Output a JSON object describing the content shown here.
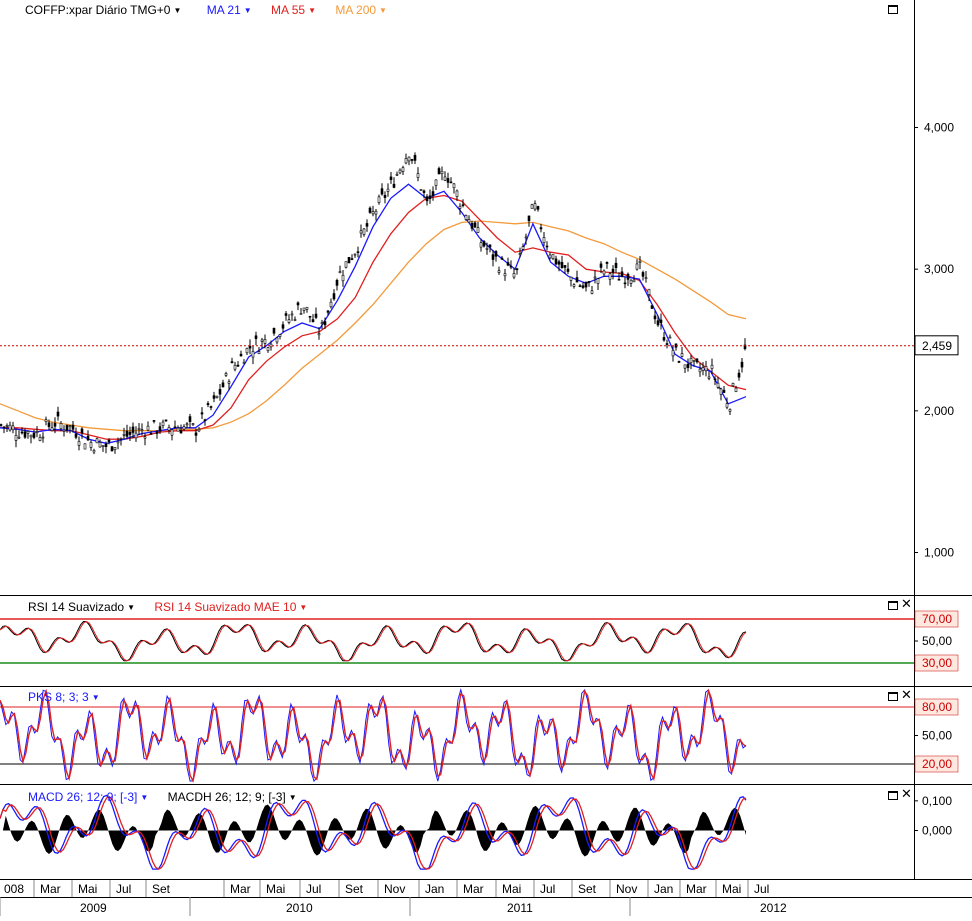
{
  "main": {
    "symbol_label": "COFFP:xpar Diário TMG+0",
    "indicators": [
      {
        "label": "MA 21",
        "color": "#1a1aff"
      },
      {
        "label": "MA 55",
        "color": "#e02020"
      },
      {
        "label": "MA 200",
        "color": "#f39a3c"
      }
    ],
    "price_ticks": [
      "4,000",
      "3,000",
      "2,000",
      "1,000"
    ],
    "last_price": "2,459"
  },
  "rsi": {
    "labels": [
      {
        "label": "RSI 14 Suavizado",
        "color": "#000000"
      },
      {
        "label": "RSI 14 Suavizado MAE 10",
        "color": "#e02020"
      }
    ],
    "ticks": [
      "70,00",
      "50,00",
      "30,00"
    ]
  },
  "pks": {
    "label": "PKS 8; 3; 3",
    "ticks": [
      "80,00",
      "50,00",
      "20,00"
    ]
  },
  "macd": {
    "labels": [
      {
        "label": "MACD 26; 12; 9; [-3]",
        "color": "#1a1aff"
      },
      {
        "label": "MACDH 26; 12; 9; [-3]",
        "color": "#000000"
      }
    ],
    "ticks": [
      "0,100",
      "0,000"
    ]
  },
  "xaxis": {
    "months": [
      "008",
      "Mar",
      "Mai",
      "Jul",
      "Set",
      "Mar",
      "Mai",
      "Jul",
      "Set",
      "Nov",
      "Jan",
      "Mar",
      "Mai",
      "Jul",
      "Set",
      "Nov",
      "Jan",
      "Mar",
      "Mai",
      "Jul"
    ],
    "years": [
      "2009",
      "2010",
      "2011",
      "2012"
    ]
  },
  "chart_data": {
    "type": "line",
    "x": [
      "2008-12",
      "2009-01",
      "2009-02",
      "2009-03",
      "2009-04",
      "2009-05",
      "2009-06",
      "2009-07",
      "2009-08",
      "2009-09",
      "2009-10",
      "2009-11",
      "2009-12",
      "2010-01",
      "2010-02",
      "2010-03",
      "2010-04",
      "2010-05",
      "2010-06",
      "2010-07",
      "2010-08",
      "2010-09",
      "2010-10",
      "2010-11",
      "2010-12",
      "2011-01",
      "2011-02",
      "2011-03",
      "2011-04",
      "2011-05",
      "2011-06",
      "2011-07",
      "2011-08",
      "2011-09",
      "2011-10",
      "2011-11",
      "2011-12",
      "2012-01",
      "2012-02",
      "2012-03",
      "2012-04",
      "2012-05",
      "2012-06"
    ],
    "ylim": [
      0.7,
      4.9
    ],
    "series": [
      {
        "name": "COFFP:xpar Diário TMG+0",
        "values": [
          1.9,
          1.86,
          1.84,
          1.92,
          1.88,
          1.78,
          1.75,
          1.82,
          1.87,
          1.88,
          1.89,
          1.87,
          2.05,
          2.3,
          2.45,
          2.5,
          2.62,
          2.75,
          2.55,
          2.95,
          3.15,
          3.4,
          3.6,
          3.85,
          3.45,
          3.7,
          3.45,
          3.2,
          3.05,
          2.95,
          3.45,
          3.1,
          2.95,
          2.85,
          3.0,
          2.95,
          3.0,
          2.62,
          2.4,
          2.3,
          2.28,
          2.05,
          2.46
        ]
      },
      {
        "name": "MA 21",
        "values": [
          1.88,
          1.87,
          1.85,
          1.87,
          1.86,
          1.8,
          1.77,
          1.8,
          1.84,
          1.86,
          1.88,
          1.88,
          1.97,
          2.17,
          2.38,
          2.46,
          2.56,
          2.62,
          2.58,
          2.78,
          3.02,
          3.3,
          3.5,
          3.6,
          3.5,
          3.55,
          3.4,
          3.22,
          3.1,
          3.0,
          3.32,
          3.05,
          2.95,
          2.9,
          2.95,
          2.95,
          2.93,
          2.68,
          2.4,
          2.32,
          2.28,
          2.05,
          2.1
        ]
      },
      {
        "name": "MA 55",
        "values": [
          1.88,
          1.88,
          1.87,
          1.86,
          1.86,
          1.83,
          1.8,
          1.8,
          1.82,
          1.85,
          1.86,
          1.86,
          1.9,
          2.02,
          2.22,
          2.35,
          2.45,
          2.53,
          2.56,
          2.65,
          2.8,
          3.05,
          3.25,
          3.4,
          3.5,
          3.52,
          3.48,
          3.35,
          3.22,
          3.12,
          3.15,
          3.12,
          3.1,
          3.0,
          2.98,
          2.97,
          2.92,
          2.75,
          2.55,
          2.38,
          2.28,
          2.18,
          2.15
        ]
      },
      {
        "name": "MA 200",
        "values": [
          2.05,
          2.0,
          1.95,
          1.92,
          1.9,
          1.88,
          1.87,
          1.86,
          1.86,
          1.86,
          1.87,
          1.87,
          1.88,
          1.92,
          1.98,
          2.07,
          2.18,
          2.3,
          2.4,
          2.5,
          2.62,
          2.75,
          2.9,
          3.05,
          3.18,
          3.28,
          3.33,
          3.34,
          3.33,
          3.32,
          3.33,
          3.3,
          3.27,
          3.22,
          3.18,
          3.12,
          3.07,
          3.0,
          2.93,
          2.85,
          2.77,
          2.68,
          2.65
        ]
      }
    ]
  }
}
